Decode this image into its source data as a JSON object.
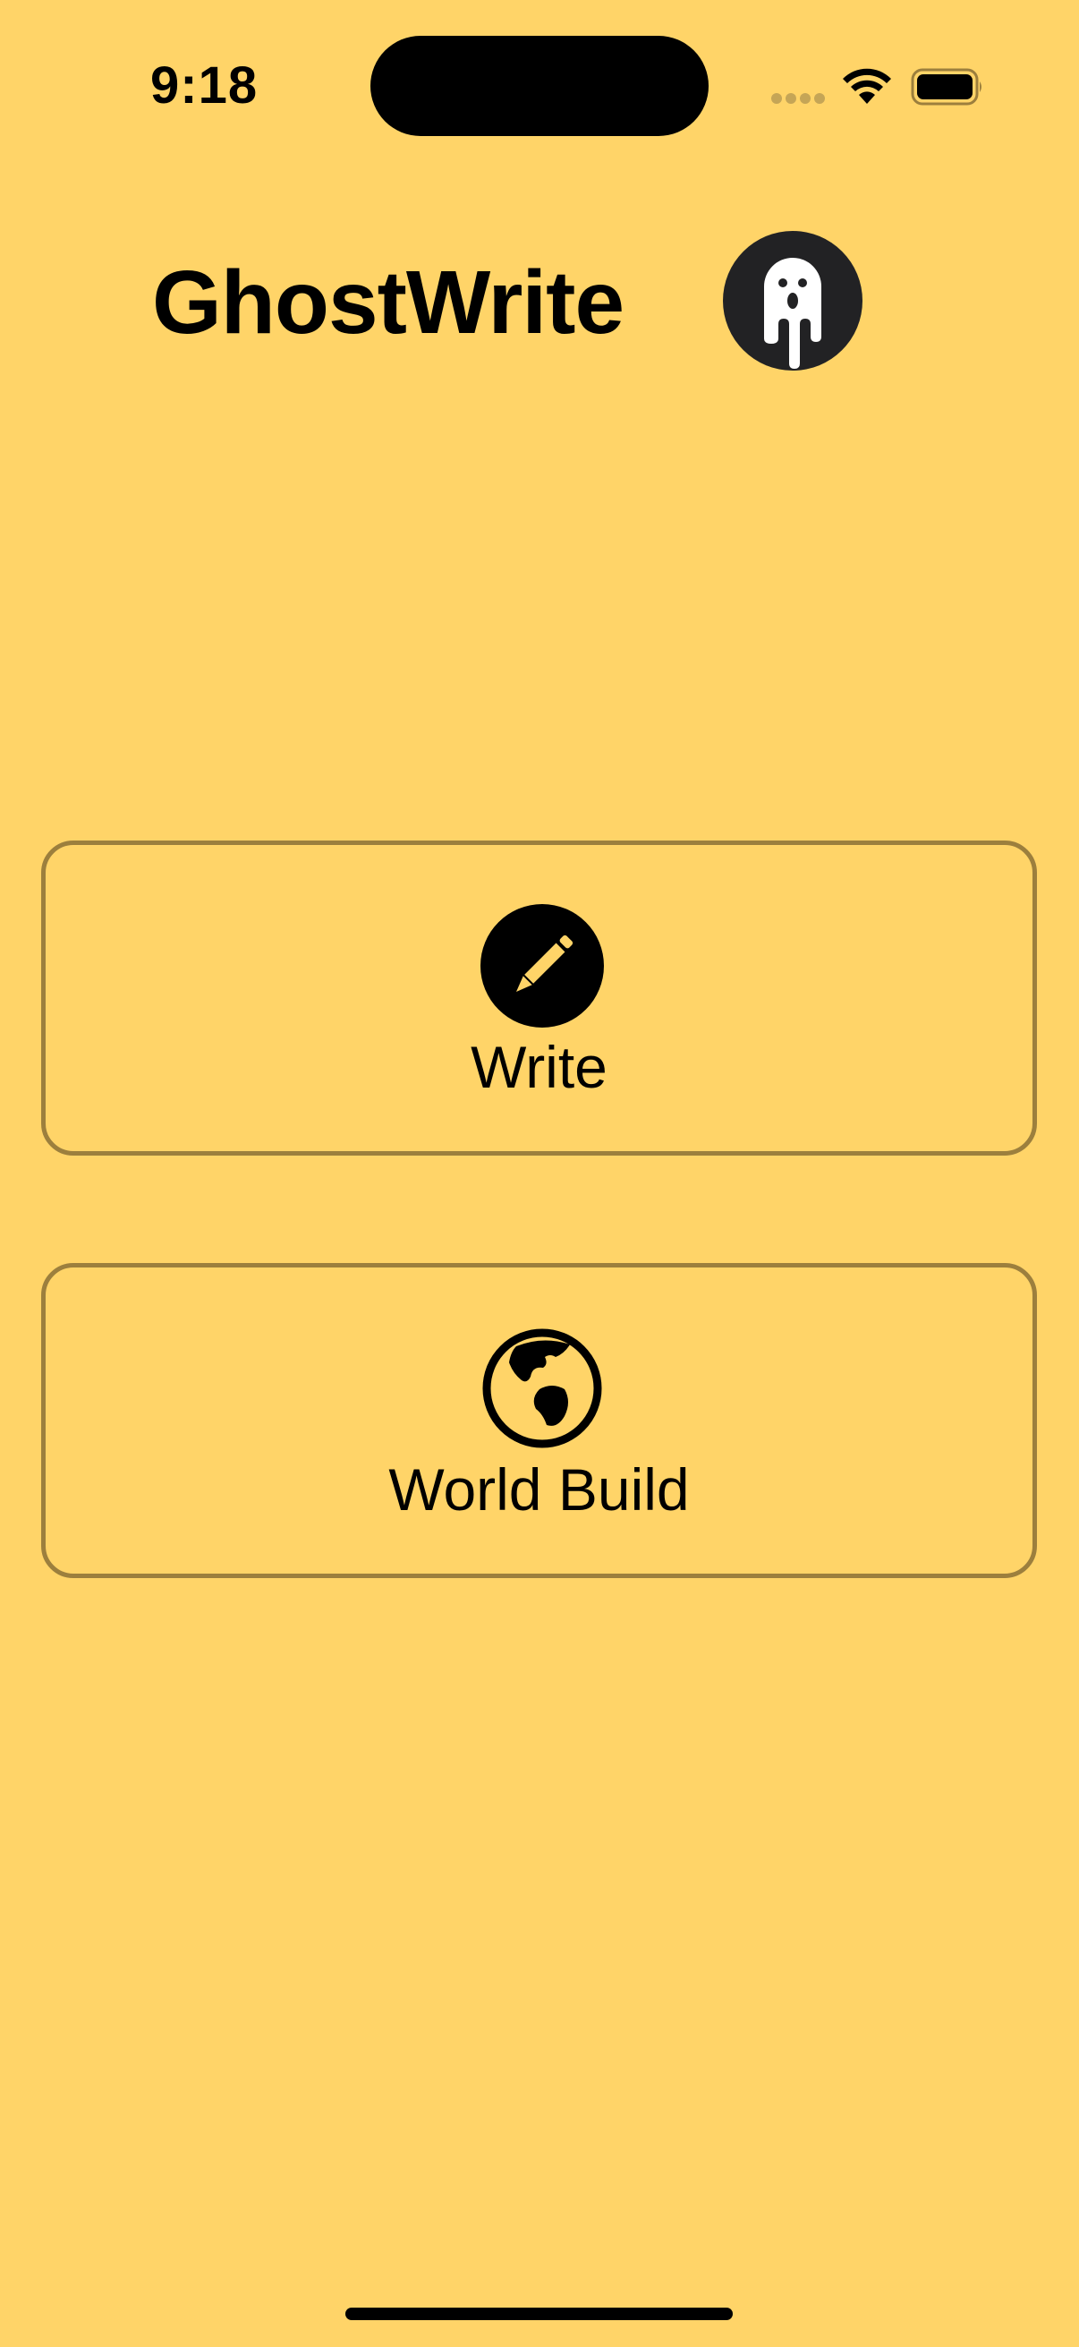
{
  "status_bar": {
    "time": "9:18",
    "icons": [
      "signal-dots-icon",
      "wifi-icon",
      "battery-icon"
    ]
  },
  "header": {
    "title": "GhostWrite",
    "avatar_icon": "ghost-icon"
  },
  "actions": [
    {
      "label": "Write",
      "icon": "pencil-icon"
    },
    {
      "label": "World Build",
      "icon": "globe-icon"
    }
  ],
  "colors": {
    "background": "#FFD468",
    "card_border": "#9C7F3D",
    "avatar_bg": "#222224",
    "text": "#000000"
  }
}
